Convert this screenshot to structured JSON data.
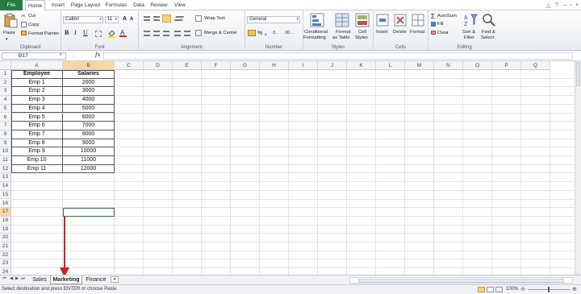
{
  "menu": {
    "tabs": [
      "File",
      "Home",
      "Insert",
      "Page Layout",
      "Formulas",
      "Data",
      "Review",
      "View"
    ]
  },
  "ribbon": {
    "clipboard": {
      "paste": "Paste",
      "cut": "Cut",
      "copy": "Copy",
      "format_painter": "Format Painter",
      "label": "Clipboard"
    },
    "font": {
      "name": "Calibri",
      "size": "11",
      "bold": "B",
      "italic": "I",
      "underline": "U",
      "label": "Font",
      "grow": "A",
      "shrink": "A"
    },
    "alignment": {
      "wrap_text": "Wrap Text",
      "merge_center": "Merge & Center",
      "label": "Alignment"
    },
    "number": {
      "format": "General",
      "label": "Number",
      "currency": "$",
      "percent": "%",
      "comma": ","
    },
    "styles": {
      "conditional_1": "Conditional",
      "conditional_2": "Formatting",
      "format_table_1": "Format",
      "format_table_2": "as Table",
      "cell_styles_1": "Cell",
      "cell_styles_2": "Styles",
      "label": "Styles"
    },
    "cells": {
      "insert": "Insert",
      "delete": "Delete",
      "format": "Format",
      "label": "Cells"
    },
    "editing": {
      "autosum": "AutoSum",
      "fill": "Fill",
      "clear": "Clear",
      "sort_1": "Sort &",
      "sort_2": "Filter",
      "find_1": "Find &",
      "find_2": "Select",
      "label": "Editing"
    }
  },
  "formula_bar": {
    "name_box": "B17",
    "fx": "fx",
    "formula": ""
  },
  "grid": {
    "columns": [
      "A",
      "B",
      "C",
      "D",
      "E",
      "F",
      "G",
      "H",
      "I",
      "J",
      "K",
      "L",
      "M",
      "N",
      "O",
      "P",
      "Q"
    ],
    "rows": [
      "1",
      "2",
      "3",
      "4",
      "5",
      "6",
      "7",
      "8",
      "9",
      "10",
      "11",
      "12",
      "13",
      "14",
      "15",
      "16",
      "17",
      "18",
      "19",
      "20",
      "21",
      "22",
      "23",
      "24"
    ],
    "table": {
      "headers": [
        "Employee",
        "Salaries"
      ],
      "data": [
        [
          "Emp 1",
          "2000"
        ],
        [
          "Emp 2",
          "3000"
        ],
        [
          "Emp 3",
          "4000"
        ],
        [
          "Emp 4",
          "5000"
        ],
        [
          "Emp 5",
          "6000"
        ],
        [
          "Emp 6",
          "7000"
        ],
        [
          "Emp 7",
          "8000"
        ],
        [
          "Emp 8",
          "9000"
        ],
        [
          "Emp 9",
          "10000"
        ],
        [
          "Emp 10",
          "11000"
        ],
        [
          "Emp 11",
          "12000"
        ]
      ]
    }
  },
  "sheets": {
    "tabs": [
      "Sales",
      "Marketing",
      "Finance"
    ],
    "active": "Marketing"
  },
  "status": {
    "text": "Select destination and press ENTER or choose Paste",
    "zoom": "100%"
  },
  "colors": {
    "file_tab": "#2a7b3f",
    "arrow": "#d0201c",
    "selected_header": "#fbd6a4"
  }
}
